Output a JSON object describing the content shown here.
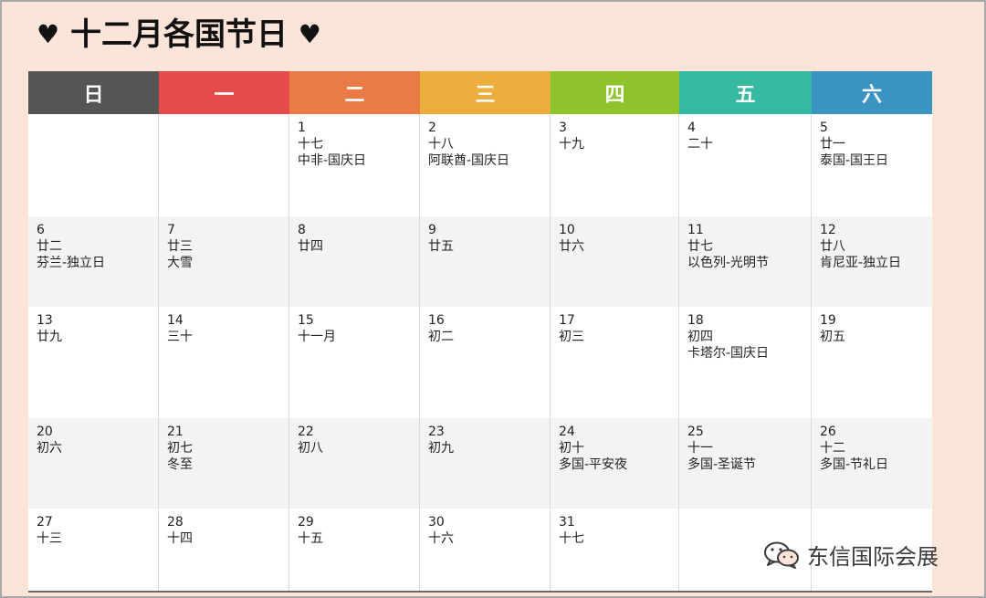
{
  "title": "十二月各国节日",
  "heart": "♥",
  "watermark": "东信国际会展",
  "weekdays": [
    {
      "label": "日",
      "color": "#555555"
    },
    {
      "label": "一",
      "color": "#e54b4b"
    },
    {
      "label": "二",
      "color": "#ea7b46"
    },
    {
      "label": "三",
      "color": "#ebad3b"
    },
    {
      "label": "四",
      "color": "#8ec42b"
    },
    {
      "label": "五",
      "color": "#35b9a0"
    },
    {
      "label": "六",
      "color": "#3a94c2"
    }
  ],
  "weeks": [
    [
      null,
      null,
      {
        "day": "1",
        "lunar": "十七",
        "holiday": "中非-国庆日"
      },
      {
        "day": "2",
        "lunar": "十八",
        "holiday": "阿联酋-国庆日"
      },
      {
        "day": "3",
        "lunar": "十九",
        "holiday": ""
      },
      {
        "day": "4",
        "lunar": "二十",
        "holiday": ""
      },
      {
        "day": "5",
        "lunar": "廿一",
        "holiday": "泰国-国王日"
      }
    ],
    [
      {
        "day": "6",
        "lunar": "廿二",
        "holiday": "芬兰-独立日"
      },
      {
        "day": "7",
        "lunar": "廿三",
        "holiday": "大雪"
      },
      {
        "day": "8",
        "lunar": "廿四",
        "holiday": ""
      },
      {
        "day": "9",
        "lunar": "廿五",
        "holiday": ""
      },
      {
        "day": "10",
        "lunar": "廿六",
        "holiday": ""
      },
      {
        "day": "11",
        "lunar": "廿七",
        "holiday": "以色列-光明节"
      },
      {
        "day": "12",
        "lunar": "廿八",
        "holiday": "肯尼亚-独立日"
      }
    ],
    [
      {
        "day": "13",
        "lunar": "廿九",
        "holiday": ""
      },
      {
        "day": "14",
        "lunar": "三十",
        "holiday": ""
      },
      {
        "day": "15",
        "lunar": "十一月",
        "holiday": ""
      },
      {
        "day": "16",
        "lunar": "初二",
        "holiday": ""
      },
      {
        "day": "17",
        "lunar": "初三",
        "holiday": ""
      },
      {
        "day": "18",
        "lunar": "初四",
        "holiday": "卡塔尔-国庆日"
      },
      {
        "day": "19",
        "lunar": "初五",
        "holiday": ""
      }
    ],
    [
      {
        "day": "20",
        "lunar": "初六",
        "holiday": ""
      },
      {
        "day": "21",
        "lunar": "初七",
        "holiday": "冬至"
      },
      {
        "day": "22",
        "lunar": "初八",
        "holiday": ""
      },
      {
        "day": "23",
        "lunar": "初九",
        "holiday": ""
      },
      {
        "day": "24",
        "lunar": "初十",
        "holiday": "多国-平安夜"
      },
      {
        "day": "25",
        "lunar": "十一",
        "holiday": "多国-圣诞节"
      },
      {
        "day": "26",
        "lunar": "十二",
        "holiday": "多国-节礼日"
      }
    ],
    [
      {
        "day": "27",
        "lunar": "十三",
        "holiday": ""
      },
      {
        "day": "28",
        "lunar": "十四",
        "holiday": ""
      },
      {
        "day": "29",
        "lunar": "十五",
        "holiday": ""
      },
      {
        "day": "30",
        "lunar": "十六",
        "holiday": ""
      },
      {
        "day": "31",
        "lunar": "十七",
        "holiday": ""
      },
      null,
      null
    ]
  ]
}
